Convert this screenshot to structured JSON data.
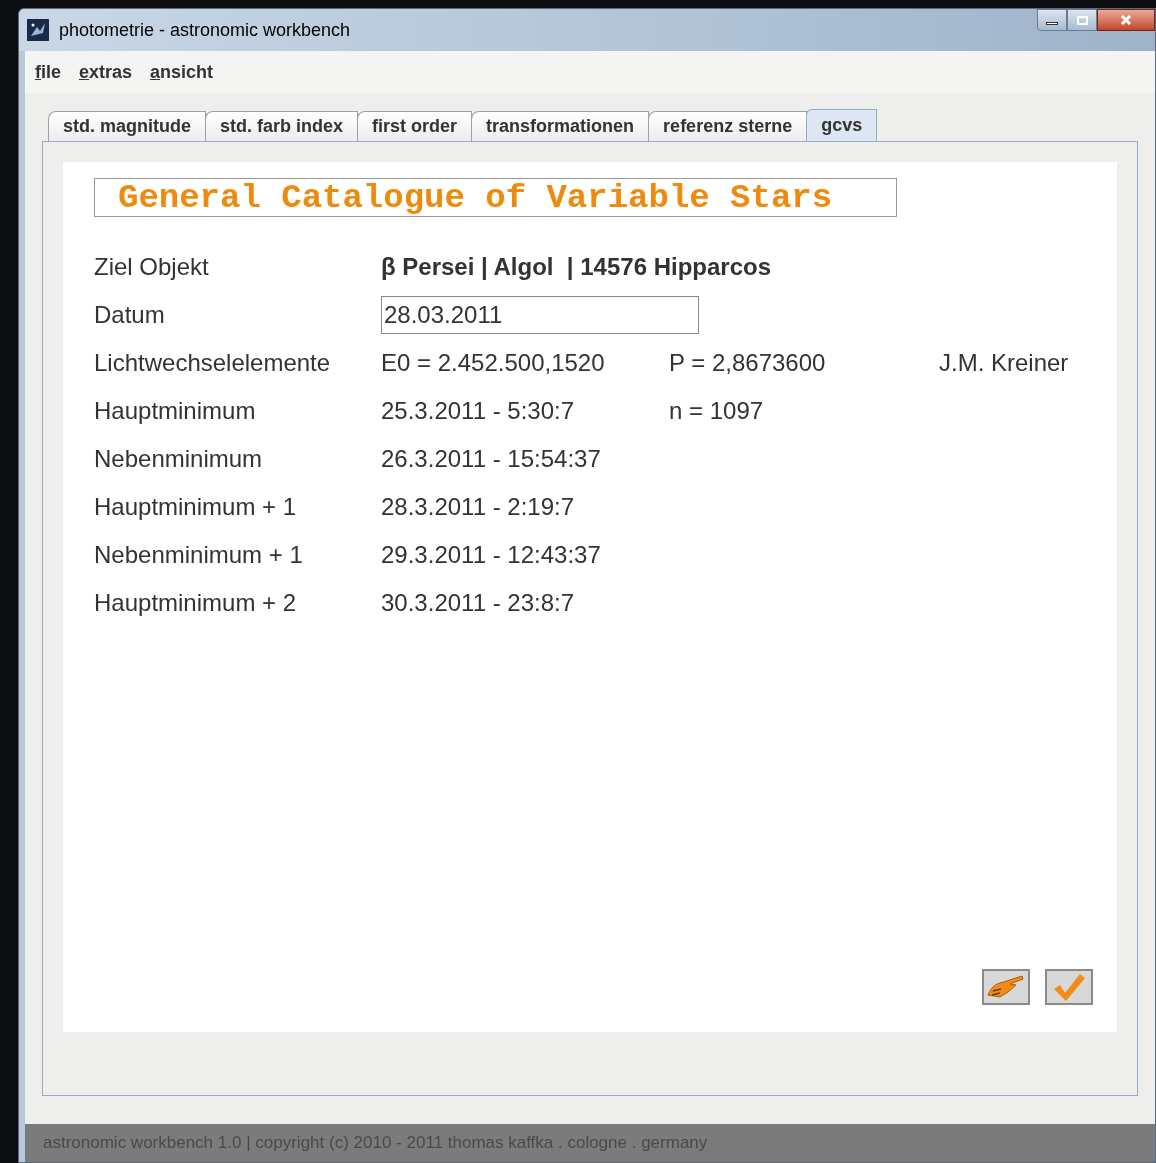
{
  "window": {
    "title": "photometrie - astronomic workbench"
  },
  "menu": [
    "file",
    "extras",
    "ansicht"
  ],
  "tabs": [
    {
      "label": "std. magnitude",
      "selected": false
    },
    {
      "label": "std. farb index",
      "selected": false
    },
    {
      "label": "first order",
      "selected": false
    },
    {
      "label": "transformationen",
      "selected": false
    },
    {
      "label": "referenz sterne",
      "selected": false
    },
    {
      "label": "gcvs",
      "selected": true
    }
  ],
  "heading": "General Catalogue of Variable Stars",
  "rows": [
    {
      "label": "Ziel Objekt",
      "kind": "bold",
      "cells": [
        "β Persei | Algol  | 14576 Hipparcos"
      ]
    },
    {
      "label": "Datum",
      "kind": "field",
      "cells": [
        "28.03.2011"
      ]
    },
    {
      "label": "Lichtwechselelemente",
      "kind": "text",
      "cells": [
        "E0 = 2.452.500,1520",
        "P = 2,8673600",
        "J.M. Kreiner"
      ]
    },
    {
      "label": "Hauptminimum",
      "kind": "text",
      "cells": [
        "25.3.2011 - 5:30:7",
        "n = 1097"
      ]
    },
    {
      "label": "Nebenminimum",
      "kind": "text",
      "cells": [
        "26.3.2011 - 15:54:37"
      ]
    },
    {
      "label": "Hauptminimum + 1",
      "kind": "text",
      "cells": [
        "28.3.2011 - 2:19:7"
      ]
    },
    {
      "label": "Nebenminimum + 1",
      "kind": "text",
      "cells": [
        "29.3.2011 - 12:43:37"
      ]
    },
    {
      "label": "Hauptminimum + 2",
      "kind": "text",
      "cells": [
        "30.3.2011 - 23:8:7"
      ]
    }
  ],
  "status_bar": "astronomic workbench 1.0 | copyright (c) 2010 - 2011 thomas kaffka . cologne . germany"
}
